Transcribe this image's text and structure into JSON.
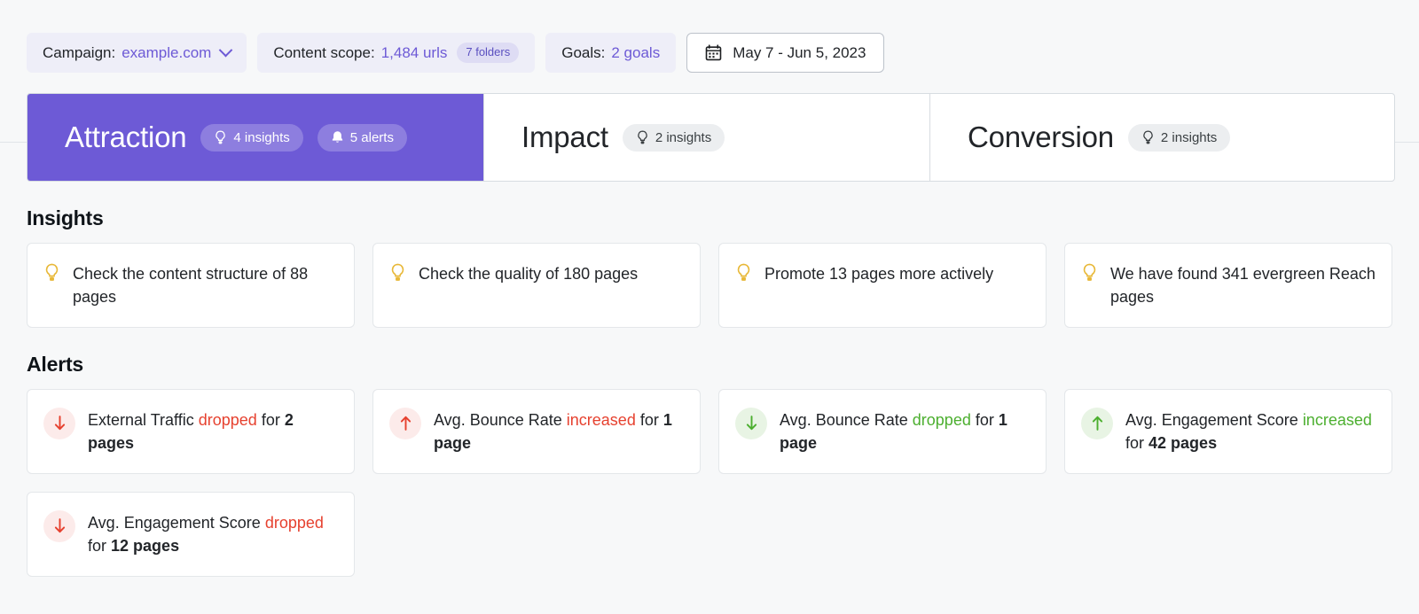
{
  "filters": {
    "campaign": {
      "label": "Campaign:",
      "value": "example.com",
      "icon": "chevron-down-icon"
    },
    "content_scope": {
      "label": "Content scope:",
      "value": "1,484 urls",
      "sub": "7 folders"
    },
    "goals": {
      "label": "Goals:",
      "value": "2 goals"
    },
    "date_range": {
      "value": "May 7 - Jun 5, 2023",
      "icon": "calendar-icon"
    }
  },
  "tabs": [
    {
      "title": "Attraction",
      "active": true,
      "badges": [
        {
          "icon": "lightbulb-icon",
          "text": "4 insights"
        },
        {
          "icon": "bell-icon",
          "text": "5 alerts"
        }
      ]
    },
    {
      "title": "Impact",
      "active": false,
      "badges": [
        {
          "icon": "lightbulb-icon",
          "text": "2 insights"
        }
      ]
    },
    {
      "title": "Conversion",
      "active": false,
      "badges": [
        {
          "icon": "lightbulb-icon",
          "text": "2 insights"
        }
      ]
    }
  ],
  "insights": {
    "title": "Insights",
    "items": [
      {
        "icon": "lightbulb-icon",
        "text": "Check the content structure of 88 pages"
      },
      {
        "icon": "lightbulb-icon",
        "text": "Check the quality of 180 pages"
      },
      {
        "icon": "lightbulb-icon",
        "text": "Promote 13 pages more actively"
      },
      {
        "icon": "lightbulb-icon",
        "text": "We have found 341 evergreen Reach pages"
      }
    ]
  },
  "alerts": {
    "title": "Alerts",
    "items": [
      {
        "icon": "arrow-down-icon",
        "direction": "down",
        "sentiment": "negative",
        "metric": "External Traffic",
        "change": "dropped",
        "connector": "for",
        "subject": "2 pages",
        "full_text": "External Traffic dropped for 2 pages"
      },
      {
        "icon": "arrow-up-icon",
        "direction": "up",
        "sentiment": "negative",
        "metric": "Avg. Bounce Rate",
        "change": "increased",
        "connector": "for",
        "subject": "1 page",
        "full_text": "Avg. Bounce Rate increased for 1 page"
      },
      {
        "icon": "arrow-down-icon",
        "direction": "down",
        "sentiment": "positive",
        "metric": "Avg. Bounce Rate",
        "change": "dropped",
        "connector": "for",
        "subject": "1 page",
        "full_text": "Avg. Bounce Rate dropped for 1 page"
      },
      {
        "icon": "arrow-up-icon",
        "direction": "up",
        "sentiment": "positive",
        "metric": "Avg. Engagement Score",
        "change": "increased",
        "connector": "for",
        "subject": "42 pages",
        "full_text": "Avg. Engagement Score increased for 42 pages"
      },
      {
        "icon": "arrow-down-icon",
        "direction": "down",
        "sentiment": "negative",
        "metric": "Avg. Engagement Score",
        "change": "dropped",
        "connector": "for",
        "subject": "12 pages",
        "full_text": "Avg. Engagement Score dropped for 12 pages"
      }
    ]
  },
  "colors": {
    "accent_purple": "#6d5ad6",
    "negative_red": "#e6412f",
    "positive_green": "#4caf2f",
    "bulb_yellow": "#e8b838",
    "page_background": "#f7f8f9"
  }
}
